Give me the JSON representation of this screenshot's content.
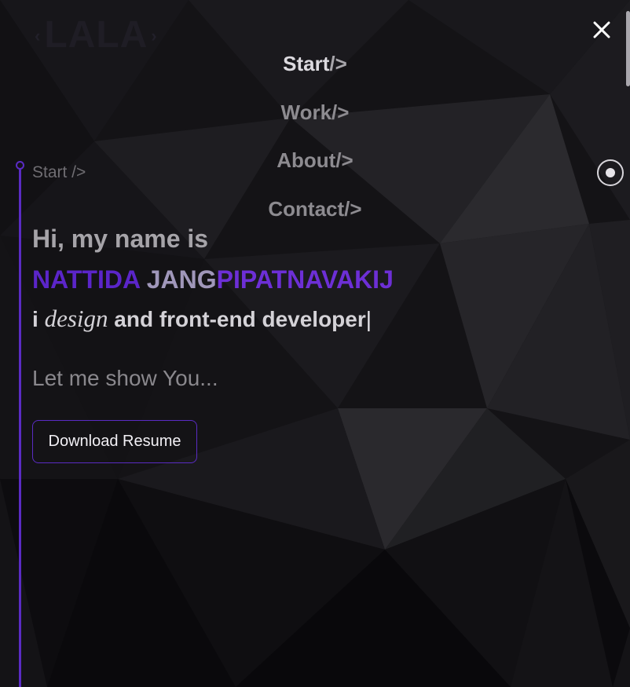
{
  "logo": {
    "text": "LALA",
    "bracket_left": "‹",
    "bracket_right": "›"
  },
  "close_icon": "close-icon",
  "menu": {
    "items": [
      {
        "label": "Start",
        "tag": "/>",
        "active": true
      },
      {
        "label": "Work",
        "tag": "/>",
        "active": false
      },
      {
        "label": "About",
        "tag": "/>",
        "active": false
      },
      {
        "label": "Contact",
        "tag": "/>",
        "active": false
      }
    ]
  },
  "section": {
    "label": "Start />"
  },
  "hero": {
    "greeting": "Hi, my name is",
    "name_first": "NATTIDA ",
    "name_mid": "JANG",
    "name_last": "PIPATNAVAKIJ",
    "role_prefix": "i ",
    "role_emphasis": "design",
    "role_suffix": " and front-end developer",
    "role_cursor": "|",
    "tagline": "Let me show You..."
  },
  "buttons": {
    "resume": "Download Resume"
  },
  "colors": {
    "accent": "#5a2bc4",
    "background": "#141316"
  }
}
